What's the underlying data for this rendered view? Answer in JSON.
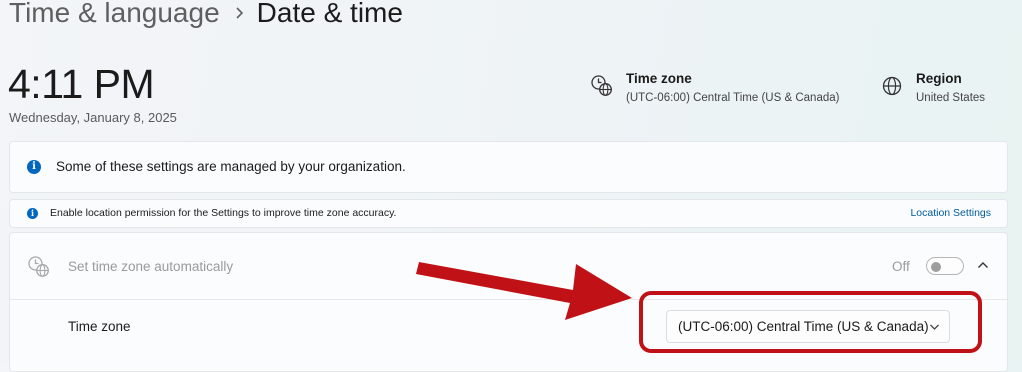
{
  "header": {
    "parent": "Time & language",
    "current": "Date & time"
  },
  "clock": {
    "time": "4:11 PM",
    "date": "Wednesday, January 8, 2025"
  },
  "summary": {
    "timezone": {
      "title": "Time zone",
      "value": "(UTC-06:00) Central Time (US & Canada)",
      "icon": "clock-globe-icon"
    },
    "region": {
      "title": "Region",
      "value": "United States",
      "icon": "globe-icon"
    }
  },
  "banners": {
    "managed": {
      "text": "Some of these settings are managed by your organization.",
      "icon": "info-icon"
    },
    "location": {
      "text": "Enable location permission for the Settings to improve time zone accuracy.",
      "link": "Location Settings",
      "icon": "info-icon"
    }
  },
  "settings": {
    "auto_timezone": {
      "label": "Set time zone automatically",
      "state_text": "Off",
      "enabled": false,
      "on": false
    },
    "timezone": {
      "label": "Time zone",
      "selected": "(UTC-06:00) Central Time (US & Canada)"
    }
  },
  "colors": {
    "accent": "#0067c0",
    "link": "#005a9e",
    "annotation": "#c01216"
  }
}
